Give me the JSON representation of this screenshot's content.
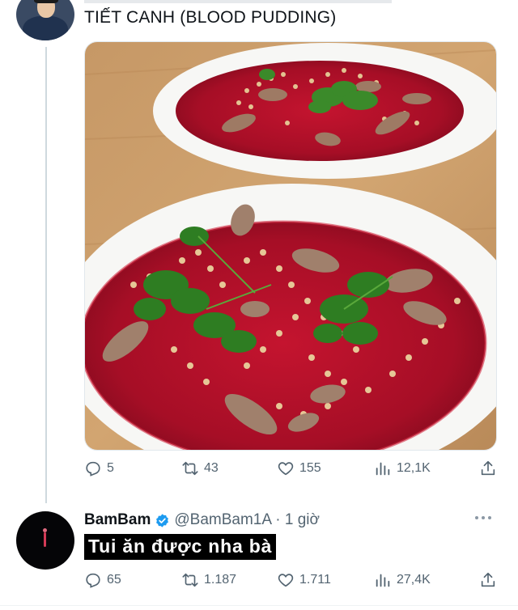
{
  "tweet": {
    "text": "TIẾT CANH (BLOOD PUDDING)",
    "image_alt": "two plates of blood pudding topped with herbs and peanuts",
    "actions": {
      "replies": "5",
      "retweets": "43",
      "likes": "155",
      "views": "12,1K"
    }
  },
  "reply": {
    "display_name": "BamBam",
    "handle_time": "@BamBam1A · 1 giờ",
    "text": "Tui ăn được nha bà",
    "actions": {
      "replies": "65",
      "retweets": "1.187",
      "likes": "1.711",
      "views": "27,4K"
    }
  },
  "icons": [
    "reply-icon",
    "retweet-icon",
    "like-icon",
    "views-icon",
    "share-icon",
    "verified-badge-icon",
    "more-icon"
  ],
  "colors": {
    "icon_gray": "#536471",
    "verified_blue": "#1d9bf0",
    "text": "#0f1419",
    "table_wood": "#c79a66",
    "blood": "#b0102a"
  }
}
